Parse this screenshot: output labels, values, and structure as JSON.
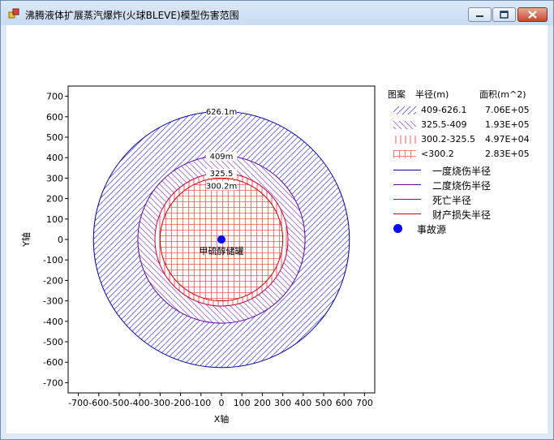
{
  "window": {
    "title": "沸腾液体扩展蒸汽爆炸(火球BLEVE)模型伤害范围",
    "controls": [
      "minimize",
      "maximize",
      "close"
    ]
  },
  "chart_data": {
    "type": "contour",
    "xlabel": "X轴",
    "ylabel": "Y轴",
    "xlim": [
      -750,
      750
    ],
    "ylim": [
      -750,
      750
    ],
    "ticks": [
      -700,
      -600,
      -500,
      -400,
      -300,
      -200,
      -100,
      0,
      100,
      200,
      300,
      400,
      500,
      600,
      700
    ],
    "center": [
      0,
      0
    ],
    "source_label": "甲硫醇储罐",
    "rings": [
      {
        "radius": 626.1,
        "label": "626.1m",
        "color": "#0000aa",
        "fill": "#5a5aff",
        "pattern": "diag-fwd"
      },
      {
        "radius": 409,
        "label": "409m",
        "color": "#6600aa",
        "fill": "#9a6ad8",
        "pattern": "diag-back"
      },
      {
        "radius": 325.5,
        "label": "325.5",
        "color": "#cc0044",
        "fill": "#ff4444",
        "pattern": "vert"
      },
      {
        "radius": 300.2,
        "label": "300.2m",
        "color": "#cc0000",
        "fill": "#ff4444",
        "pattern": "grid"
      }
    ]
  },
  "legend": {
    "headers": {
      "pattern": "图案",
      "radius": "半径(m)",
      "area": "面积(m^2)"
    },
    "rows": [
      {
        "range": "409-626.1",
        "area": "7.06E+05",
        "pattern": "diag-fwd",
        "color": "#5a5aff"
      },
      {
        "range": "325.5-409",
        "area": "1.93E+05",
        "pattern": "diag-back",
        "color": "#9a6ad8"
      },
      {
        "range": "300.2-325.5",
        "area": "4.97E+04",
        "pattern": "vert",
        "color": "#ff4444"
      },
      {
        "range": "<300.2",
        "area": "2.83E+05",
        "pattern": "grid",
        "color": "#ff4444"
      }
    ],
    "lines": [
      {
        "name": "一度烧伤半径",
        "color": "#0000aa"
      },
      {
        "name": "二度烧伤半径",
        "color": "#6600aa"
      },
      {
        "name": "死亡半径",
        "color": "#cc0044"
      },
      {
        "name": "财产损失半径",
        "color": "#cc0000"
      }
    ],
    "source": {
      "name": "事故源",
      "color": "#0000ff"
    }
  }
}
